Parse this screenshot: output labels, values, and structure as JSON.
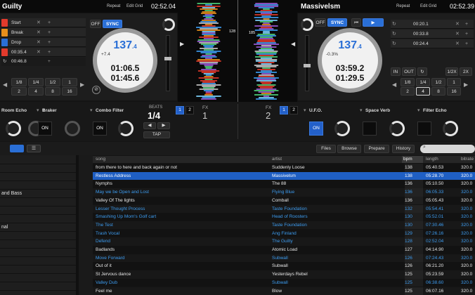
{
  "deck_left": {
    "title": "Guilty",
    "repeat_label": "Repeat",
    "edit_grid_label": "Edit Grid",
    "time": "02:52.04",
    "cues": [
      {
        "label": "Start",
        "color": "#e23a2c"
      },
      {
        "label": "Break",
        "color": "#e88f1b"
      },
      {
        "label": "Drop",
        "color": "#2a6fd6"
      },
      {
        "label": "00:35.4",
        "color": "#e23a2c"
      }
    ],
    "loop_value": "00:46.8",
    "off_label": "OFF",
    "sync_label": "SYNC",
    "bpm_main": "137",
    "bpm_decimal": ".4",
    "pitch": "+7.4",
    "time_elapsed": "01:06.5",
    "time_remaining": "01:45.6",
    "loop_sizes_row1": [
      "1/8",
      "1/4",
      "1/2",
      "1"
    ],
    "loop_sizes_row2": [
      "2",
      "4",
      "8",
      "16"
    ],
    "pitch_range": "16"
  },
  "deck_right": {
    "title": "Massivelsm",
    "repeat_label": "Repeat",
    "edit_grid_label": "Edit Grid",
    "time": "02:52.39",
    "off_label": "OFF",
    "sync_label": "SYNC",
    "bpm_main": "137",
    "bpm_decimal": ".4",
    "pitch": "-0.3%",
    "time_elapsed": "03:59.2",
    "time_remaining": "01:29.5",
    "cues": [
      "00:20.1",
      "00:33.8",
      "00:24.4"
    ],
    "in_label": "IN",
    "out_label": "OUT",
    "half_label": "1/2X",
    "double_label": "2X",
    "loop_sizes_row1": [
      "1/8",
      "1/4",
      "1/2",
      "1"
    ],
    "loop_sizes_row2": [
      "2",
      "4",
      "8",
      "16"
    ]
  },
  "waveform_center": {
    "beat_marker_left": "128",
    "beat_marker_right": "185"
  },
  "fx": {
    "left": [
      {
        "name": "Room Echo",
        "toggle": ""
      },
      {
        "name": "Braker",
        "toggle": "ON"
      },
      {
        "name": "Combo Filter",
        "toggle": "ON"
      }
    ],
    "beats_label": "BEATS",
    "beats_value": "1/4",
    "tap_label": "TAP",
    "unit_1": "1",
    "unit_2": "2",
    "fx1_label": "FX",
    "fx1_num": "1",
    "fx2_label": "FX",
    "fx2_num": "2",
    "right": [
      {
        "name": "U.F.O.",
        "toggle": "ON"
      },
      {
        "name": "Space Verb",
        "toggle": ""
      },
      {
        "name": "Filter Echo",
        "toggle": ""
      }
    ]
  },
  "library": {
    "tabs": [
      "Files",
      "Browse",
      "Prepare",
      "History"
    ],
    "columns": [
      "song",
      "artist",
      "bpm",
      "length",
      "bitrate"
    ],
    "sidebar": [
      "",
      "",
      "",
      "",
      "and Bass",
      "",
      "",
      "",
      "nal",
      "",
      "",
      "",
      "",
      "",
      "",
      ""
    ],
    "rows": [
      {
        "song": "from there to here and back again or not",
        "artist": "Suddenly Loose",
        "bpm": "138",
        "length": "05:40.53",
        "bitrate": "320.0",
        "color": "#e6e6e6"
      },
      {
        "song": "Restless Address",
        "artist": "Massivelsm",
        "bpm": "138",
        "length": "05:28.70",
        "bitrate": "320.0",
        "color": "#ffffff",
        "selected": true
      },
      {
        "song": "Nymphs",
        "artist": "The 88",
        "bpm": "136",
        "length": "05:10.50",
        "bitrate": "320.0",
        "color": "#e6e6e6"
      },
      {
        "song": "May we be Open and Lost",
        "artist": "Flying Blue",
        "bpm": "136",
        "length": "06:05.33",
        "bitrate": "320.0",
        "color": "#3d9cf0"
      },
      {
        "song": "Valley Of The lights",
        "artist": "Comball",
        "bpm": "136",
        "length": "05:05.43",
        "bitrate": "320.0",
        "color": "#e6e6e6"
      },
      {
        "song": "Lesser Thought Process",
        "artist": "Taste Foundation",
        "bpm": "132",
        "length": "05:54.41",
        "bitrate": "320.0",
        "color": "#3d9cf0"
      },
      {
        "song": "Smashing Up Mom's Golf cart",
        "artist": "Head of Roosters",
        "bpm": "130",
        "length": "05:52.01",
        "bitrate": "320.0",
        "color": "#3d9cf0"
      },
      {
        "song": "The Test",
        "artist": "Taste Foundation",
        "bpm": "130",
        "length": "07:30.46",
        "bitrate": "320.0",
        "color": "#3d9cf0"
      },
      {
        "song": "Trash Vocal",
        "artist": "Ang Finland",
        "bpm": "129",
        "length": "07:26.16",
        "bitrate": "320.0",
        "color": "#3d9cf0"
      },
      {
        "song": "Defend",
        "artist": "The Guilty",
        "bpm": "128",
        "length": "02:52.04",
        "bitrate": "320.0",
        "color": "#3d9cf0"
      },
      {
        "song": "Badlands",
        "artist": "Atomic Load",
        "bpm": "127",
        "length": "04:14.90",
        "bitrate": "320.0",
        "color": "#e6e6e6"
      },
      {
        "song": "Move Forward",
        "artist": "Subwall",
        "bpm": "126",
        "length": "07:24.43",
        "bitrate": "320.0",
        "color": "#3d9cf0"
      },
      {
        "song": "Out of it",
        "artist": "Subwall",
        "bpm": "126",
        "length": "06:21.20",
        "bitrate": "320.0",
        "color": "#e6e6e6"
      },
      {
        "song": "St Jervous dance",
        "artist": "Yesterdays Rebel",
        "bpm": "125",
        "length": "05:23.59",
        "bitrate": "320.0",
        "color": "#e6e6e6"
      },
      {
        "song": "Valley Dub",
        "artist": "Subwall",
        "bpm": "125",
        "length": "06:38.60",
        "bitrate": "320.0",
        "color": "#3d9cf0"
      },
      {
        "song": "Feel me",
        "artist": "Blow",
        "bpm": "125",
        "length": "06:07.16",
        "bitrate": "320.0",
        "color": "#e6e6e6"
      }
    ]
  },
  "colors": {
    "accent_blue": "#2a6fd6",
    "row_selected": "#1f5fc4",
    "background": "#141414"
  }
}
